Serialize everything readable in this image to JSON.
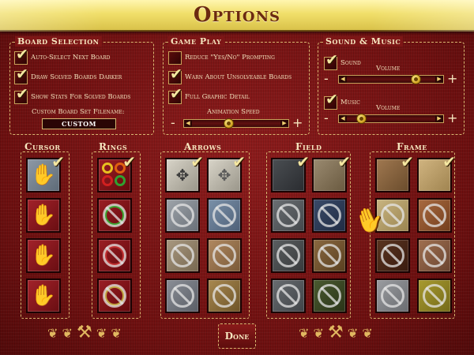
{
  "title": "Options",
  "board_selection": {
    "title": "Board Selection",
    "options": [
      {
        "label": "Auto-Select Next Board",
        "checked": true
      },
      {
        "label": "Draw Solved Boards Darker",
        "checked": true
      },
      {
        "label": "Show Stats For Solved Boards",
        "checked": true
      }
    ],
    "filename_label": "Custom Board Set Filename:",
    "filename_value": "CUSTOM"
  },
  "game_play": {
    "title": "Game Play",
    "options": [
      {
        "label": "Reduce \"Yes/No\" Prompting",
        "checked": false
      },
      {
        "label": "Warn About Unsolveable Boards",
        "checked": true
      },
      {
        "label": "Full Graphic Detail",
        "checked": true
      }
    ],
    "speed_label": "Animation Speed",
    "speed_level": 0.4
  },
  "sound_music": {
    "title": "Sound & Music",
    "sound_label": "Sound",
    "sound_checked": true,
    "sound_volume_label": "Volume",
    "sound_volume": 0.82,
    "music_label": "Music",
    "music_checked": true,
    "music_volume_label": "Volume",
    "music_volume": 0.12
  },
  "columns": {
    "cursor": "Cursor",
    "rings": "Rings",
    "arrows": "Arrows",
    "field": "Field",
    "frame": "Frame"
  },
  "buttons": {
    "done": "Done",
    "minus": "-",
    "plus": "+"
  },
  "icons": {
    "check": "✔",
    "hand": "✋",
    "pointer": "☚",
    "ornament": "❦",
    "anvil": "⚒"
  },
  "colors": {
    "banner": "#f1df6a",
    "background": "#7a1414",
    "accent": "#d8b670",
    "check": "#f4e6a0"
  }
}
